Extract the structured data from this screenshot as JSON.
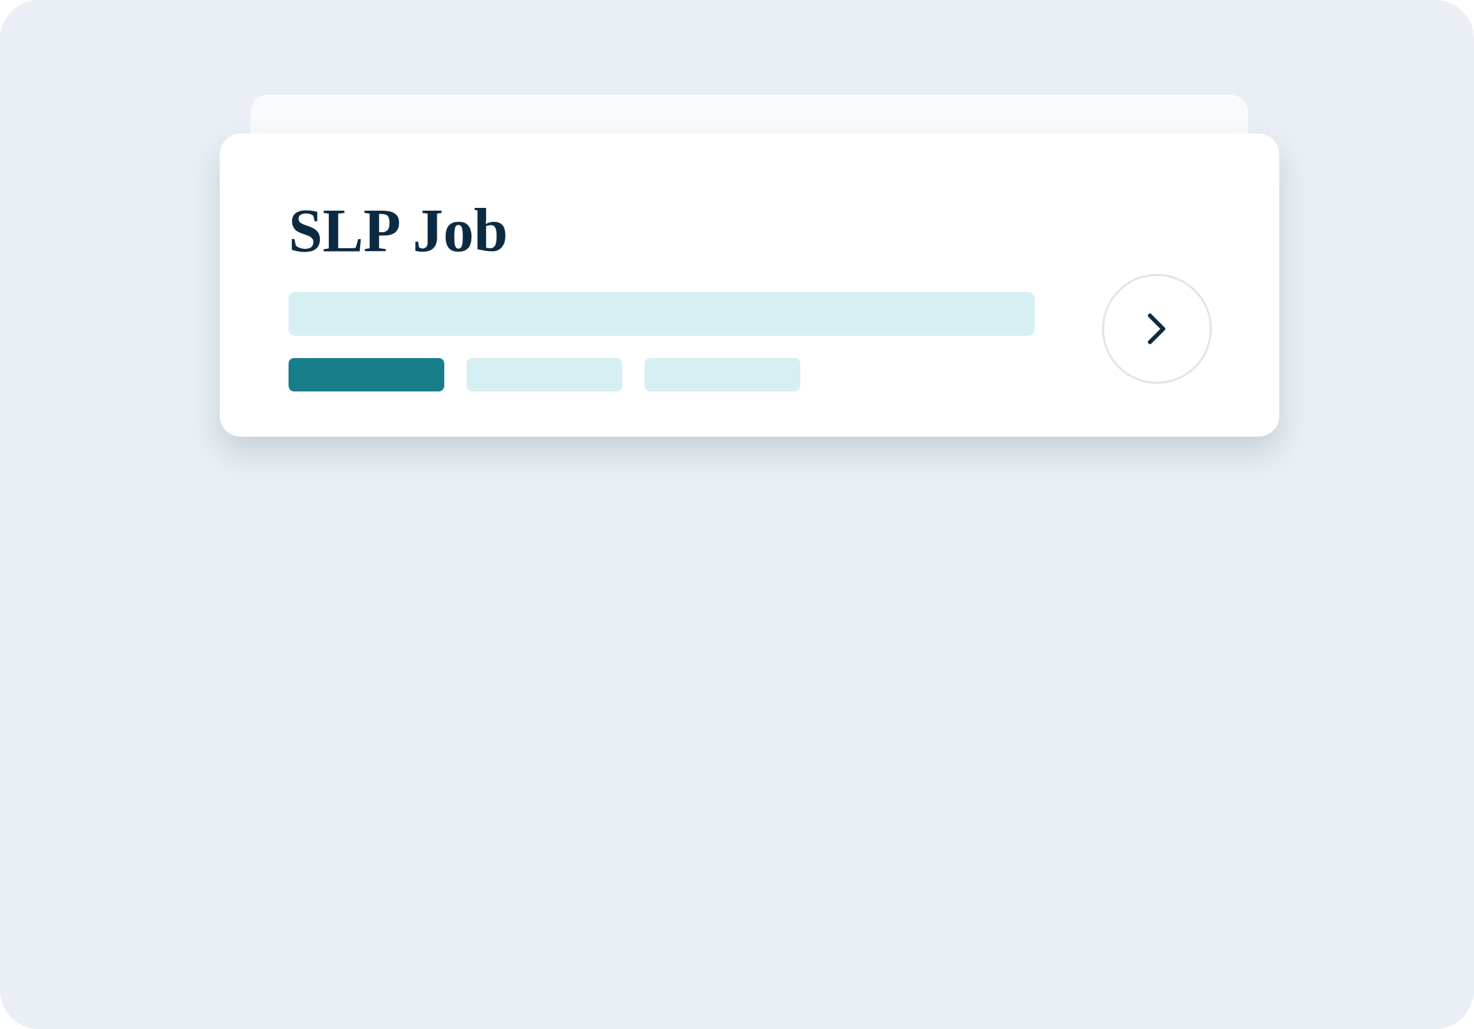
{
  "card": {
    "title": "SLP Job",
    "tags": [
      {
        "color": "#167e89"
      },
      {
        "color": "#d6eff2"
      },
      {
        "color": "#d6eff2"
      }
    ]
  }
}
